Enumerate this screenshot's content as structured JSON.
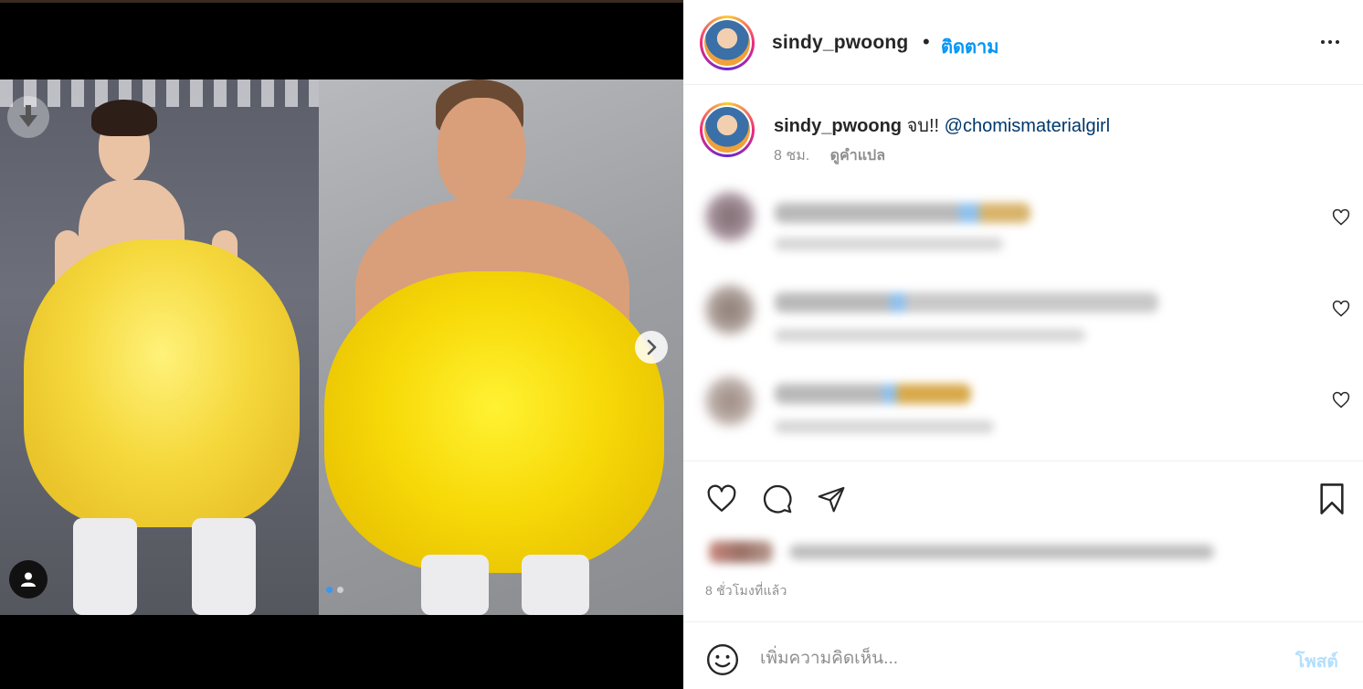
{
  "post": {
    "author": "sindy_pwoong",
    "bullet": "•",
    "follow_label": "ติดตาม",
    "caption_text": "จบ!!",
    "caption_mention": "@chomismaterialgirl",
    "caption_time": "8 ชม.",
    "translate_label": "ดูคำแปล",
    "timestamp": "8 ชั่วโมงที่แล้ว",
    "comment_placeholder": "เพิ่มความคิดเห็น...",
    "post_label": "โพสต์"
  },
  "carousel": {
    "slide_count": 2,
    "active_slide": 1
  },
  "icons": {
    "download": "download-icon",
    "next": "chevron-right-icon",
    "user_tag": "user-icon",
    "more": "more-horizontal-icon",
    "like": "heart-icon",
    "comment": "comment-icon",
    "share": "send-icon",
    "save": "bookmark-icon",
    "emoji": "emoji-icon"
  },
  "colors": {
    "accent": "#0095f6",
    "text": "#262626",
    "secondary": "#8e8e8e",
    "post_disabled": "#b2dffc"
  }
}
